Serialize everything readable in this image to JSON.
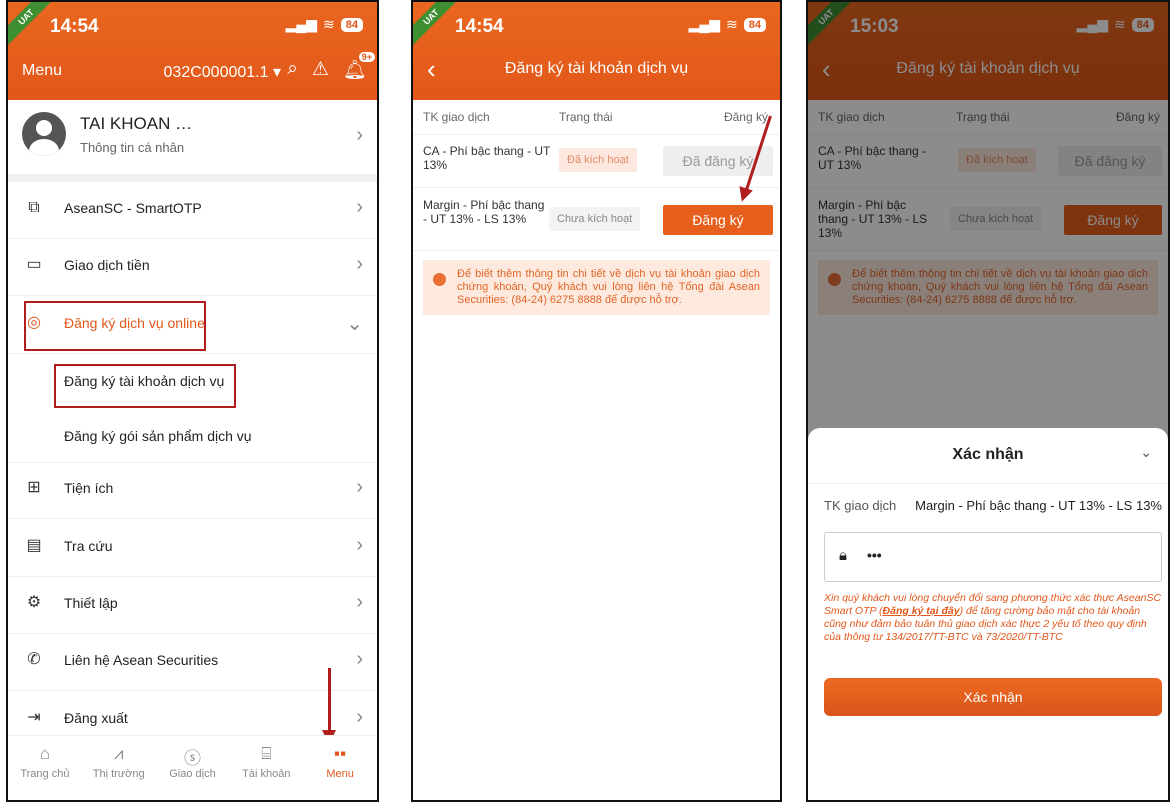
{
  "colors": {
    "accent": "#e2571a",
    "annotation_red": "#b01d1d"
  },
  "phone1": {
    "status": {
      "time": "14:54",
      "signal": "▂▄▆",
      "wifi": "≋",
      "battery": "84",
      "env": "UAT"
    },
    "header": {
      "menu": "Menu",
      "account": "032C000001.1 ▾",
      "bell_badge": "9+"
    },
    "profile": {
      "name": "TAI KHOAN …",
      "sub": "Thông tin cá nhân"
    },
    "items": {
      "otp": "AseanSC - SmartOTP",
      "money": "Giao dịch tiền",
      "online": "Đăng ký dịch vụ online",
      "sub1": "Đăng ký tài khoản dịch vụ",
      "sub2": "Đăng ký gói sản phẩm dịch vụ",
      "utility": "Tiện ích",
      "lookup": "Tra cứu",
      "settings": "Thiết lập",
      "contact": "Liên hệ Asean Securities",
      "logout": "Đăng xuất"
    },
    "tabs": [
      "Trang chủ",
      "Thị trường",
      "Giao dịch",
      "Tài khoản",
      "Menu"
    ]
  },
  "phone2": {
    "status": {
      "time": "14:54",
      "signal": "▂▄▆",
      "wifi": "≋",
      "battery": "84",
      "env": "UAT"
    },
    "title": "Đăng ký tài khoản dịch vụ",
    "table": {
      "headers": [
        "TK giao dịch",
        "Trạng thái",
        "Đăng ký"
      ],
      "rows": [
        {
          "name": "CA - Phí bậc thang - UT 13%",
          "status": "Đã kích hoạt",
          "action": "Đã đăng ký"
        },
        {
          "name": "Margin - Phí bậc thang - UT 13% - LS 13%",
          "status": "Chưa kích hoạt",
          "action": "Đăng ký"
        }
      ]
    },
    "note": "Để biết thêm thông tin chi tiết về dịch vụ tài khoản giao dịch chứng khoán, Quý khách vui lòng liên hệ Tổng đài Asean Securities: (84-24) 6275 8888 để được hỗ trợ."
  },
  "phone3": {
    "status": {
      "time": "15:03",
      "signal": "▂▄▆",
      "wifi": "≋",
      "battery": "84",
      "env": "UAT"
    },
    "sheet": {
      "title": "Xác nhận",
      "label": "TK giao dịch",
      "value": "Margin - Phí bậc thang - UT 13% - LS 13%",
      "password": "•••",
      "warn_before": "Xin quý khách vui lòng chuyển đổi sang phương thức xác thực AseanSC Smart OTP (",
      "warn_link": "Đăng ký tại đây",
      "warn_after": ") để tăng cường bảo mật cho tài khoản cũng như đảm bảo tuân thủ giao dịch xác thực 2 yếu tố theo quy định của thông tư 134/2017/TT-BTC và 73/2020/TT-BTC",
      "button": "Xác nhận"
    }
  }
}
